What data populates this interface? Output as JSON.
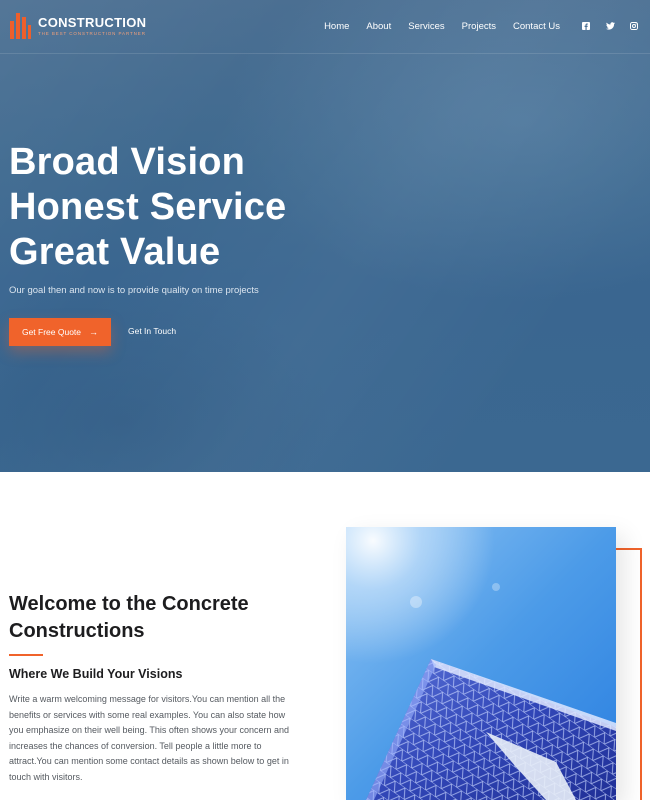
{
  "brand": {
    "name": "CONSTRUCTION",
    "tagline": "THE BEST CONSTRUCTION PARTNER",
    "accent": "#f0632b"
  },
  "nav": {
    "items": [
      "Home",
      "About",
      "Services",
      "Projects",
      "Contact Us"
    ]
  },
  "social": [
    "facebook-icon",
    "twitter-icon",
    "instagram-icon"
  ],
  "hero": {
    "lines": [
      "Broad Vision",
      "Honest Service",
      "Great Value"
    ],
    "subtitle": "Our goal then and now is to provide quality on time projects",
    "primary_button": "Get Free Quote",
    "secondary_button": "Get In Touch"
  },
  "welcome": {
    "title": "Welcome to the Concrete Constructions",
    "subtitle": "Where We Build Your Visions",
    "body": "Write a warm welcoming message for visitors.You can mention all the benefits or services with some real examples. You can also state how you emphasize on their well being. This often shows your concern and increases the chances of conversion. Tell people a little more to attract.You can mention some contact details as shown below to get in touch with visitors."
  }
}
